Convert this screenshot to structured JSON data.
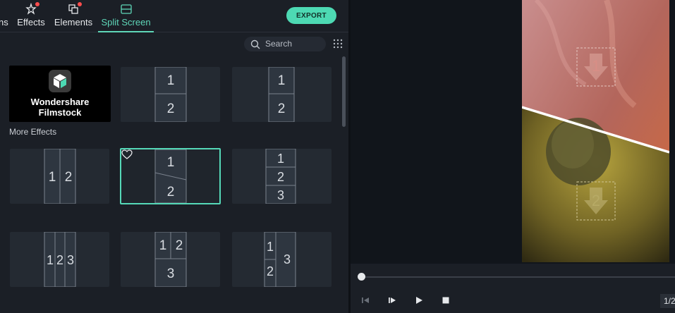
{
  "tabs": [
    {
      "label": "ns",
      "icon": "titles-icon",
      "has_dot": false
    },
    {
      "label": "Effects",
      "icon": "effects-icon",
      "has_dot": true
    },
    {
      "label": "Elements",
      "icon": "elements-icon",
      "has_dot": true
    },
    {
      "label": "Split Screen",
      "icon": "split-screen-icon",
      "active": true
    }
  ],
  "toolbar": {
    "export_label": "EXPORT"
  },
  "search": {
    "label": "Search"
  },
  "filmstock": {
    "line1": "Wondershare",
    "line2": "Filmstock"
  },
  "section": {
    "more_effects": "More Effects"
  },
  "tiles": {
    "t1": [
      "1",
      "2"
    ],
    "t2": [
      "1",
      "2"
    ],
    "t3": [
      "1",
      "2"
    ],
    "t4": [
      "1",
      "2"
    ],
    "t5": [
      "1",
      "2",
      "3"
    ],
    "t6": [
      "1",
      "2",
      "3"
    ],
    "t7": [
      "1",
      "2",
      "3"
    ],
    "t8": [
      "1",
      "2",
      "3"
    ]
  },
  "preview": {
    "drop_1": "1",
    "drop_2": "2"
  },
  "player": {
    "timecode": "1/2",
    "progress": 0.0
  },
  "colors": {
    "accent": "#4dd9b3",
    "badge": "#ff4d4d",
    "panel": "#1b1f26"
  }
}
